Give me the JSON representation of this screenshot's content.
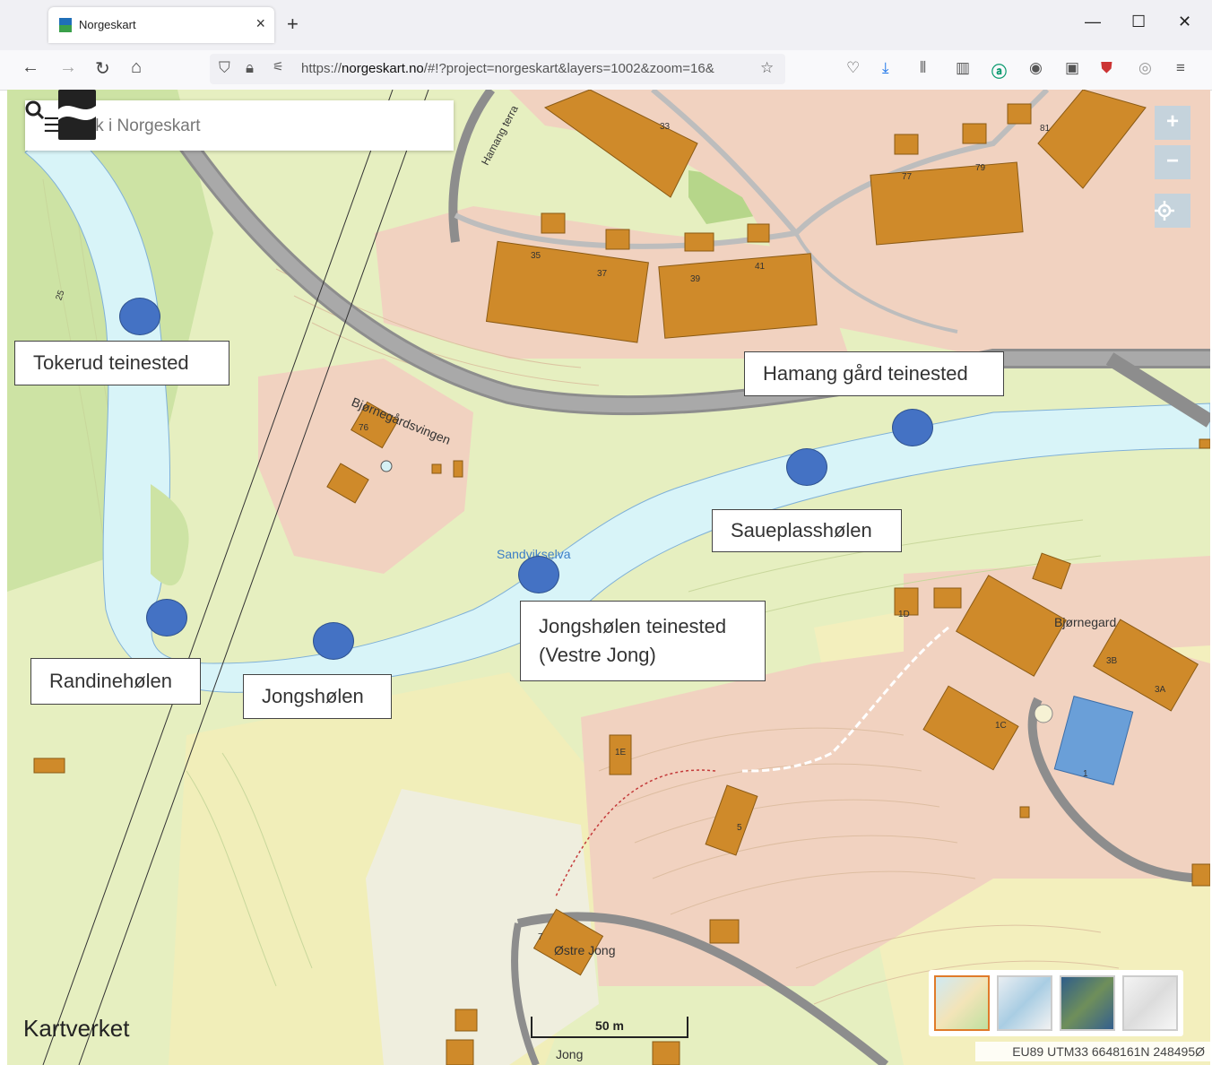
{
  "browser": {
    "tab_title": "Norgeskart",
    "url_host": "norgeskart.no",
    "url_prefix": "https://",
    "url_rest": "/#!?project=norgeskart&layers=1002&zoom=16&"
  },
  "search": {
    "placeholder": "Søk i Norgeskart"
  },
  "zoom": {
    "in_label": "+",
    "out_label": "−"
  },
  "labels": {
    "tokerud": "Tokerud teinested",
    "hamang": "Hamang gård teinested",
    "saueplass": "Saueplasshølen",
    "jongsholen_teinested_line1": "Jongshølen teinested",
    "jongsholen_teinested_line2": "(Vestre Jong)",
    "randine": "Randinehølen",
    "jongsholen": "Jongshølen"
  },
  "map_text": {
    "road_bjornegard": "Bjørnegårdsvingen",
    "road_hamang": "Hamang terra",
    "river": "Sandvikselva",
    "place_bjornegard": "Bjørnegard",
    "place_ostre_jong": "Østre Jong",
    "place_jong": "Jong",
    "house_33": "33",
    "house_35": "35",
    "house_37": "37",
    "house_39": "39",
    "house_41": "41",
    "house_77": "77",
    "house_79": "79",
    "house_81": "81",
    "house_76": "76",
    "house_1d": "1D",
    "house_3b": "3B",
    "house_3a": "3A",
    "house_1c": "1C",
    "house_1e": "1E",
    "house_1": "1",
    "house_5": "5",
    "house_7": "7",
    "contour_25": "25"
  },
  "logo": {
    "text": "Kartverket"
  },
  "scale": {
    "label": "50 m"
  },
  "coords": {
    "text": "EU89 UTM33 6648161N 248495Ø"
  },
  "colors": {
    "marker": "#4472c4",
    "water": "#d8f4f8",
    "building": "#cf8a2a",
    "residential": "#f1d2c0",
    "road": "#8d8d8d"
  }
}
